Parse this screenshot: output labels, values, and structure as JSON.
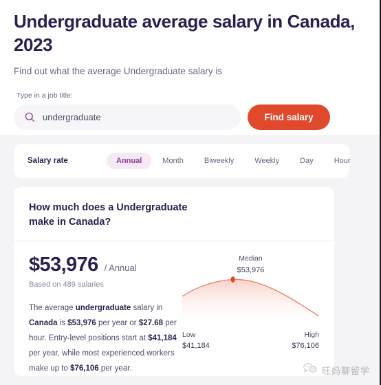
{
  "header": {
    "title": "Undergraduate average salary in Canada, 2023",
    "subtitle": "Find out what the average Undergraduate salary is"
  },
  "search": {
    "label": "Type in a job title:",
    "value": "undergraduate",
    "placeholder": "undergraduate",
    "icon": "search-icon",
    "button_label": "Find salary"
  },
  "salary_rate": {
    "label": "Salary rate",
    "selected": "Annual",
    "options": [
      "Annual",
      "Month",
      "Biweekly",
      "Weekly",
      "Day",
      "Hour"
    ]
  },
  "result": {
    "question": "How much does a Undergraduate make in Canada?",
    "amount": "$53,976",
    "period": "/ Annual",
    "based_on": "Based on 489 salaries",
    "description": {
      "p1": "The average ",
      "b1": "undergraduate",
      "p2": " salary in ",
      "b2": "Canada",
      "p3": " is ",
      "b3": "$53,976",
      "p4": " per year or ",
      "b4": "$27.68",
      "p5": " per hour. Entry-level positions start at ",
      "b5": "$41,184",
      "p6": " per year, while most experienced workers make up to ",
      "b6": "$76,106",
      "p7": " per year."
    }
  },
  "chart_data": {
    "type": "area",
    "title": "",
    "xlabel": "",
    "ylabel": "",
    "grid": false,
    "legend_position": "none",
    "annotations": [
      {
        "name": "Median",
        "value": "$53,976",
        "position": "peak",
        "marker": true
      },
      {
        "name": "Low",
        "value": "$41,184",
        "position": "left"
      },
      {
        "name": "High",
        "value": "$76,106",
        "position": "right"
      }
    ],
    "categories": [
      "Low",
      "Median",
      "High"
    ],
    "values": [
      41184,
      53976,
      76106
    ],
    "curve_points": [
      {
        "x": 0,
        "y": 0.62
      },
      {
        "x": 0.12,
        "y": 0.78
      },
      {
        "x": 0.3,
        "y": 0.92
      },
      {
        "x": 0.37,
        "y": 0.96
      },
      {
        "x": 0.5,
        "y": 0.9
      },
      {
        "x": 0.7,
        "y": 0.68
      },
      {
        "x": 0.85,
        "y": 0.44
      },
      {
        "x": 1,
        "y": 0.2
      }
    ],
    "marker": {
      "x": 0.37,
      "y": 0.96,
      "color": "#e8452a"
    },
    "line_color": "#ee7b63",
    "fill_top_color": "#f9d9d2",
    "fill_bottom_color": "#ffffff"
  },
  "watermark": {
    "text": "旺妈聊留学",
    "icon": "wechat-icon"
  },
  "colors": {
    "accent_red": "#e0492c",
    "title_navy": "#2c1f4f",
    "tab_active_bg": "#f4e9f4",
    "tab_active_text": "#8e3f8e",
    "page_bg": "#f4f4f6",
    "search_bg": "#f6f6f8",
    "chart_line": "#ee7b63",
    "chart_marker": "#e8452a"
  }
}
